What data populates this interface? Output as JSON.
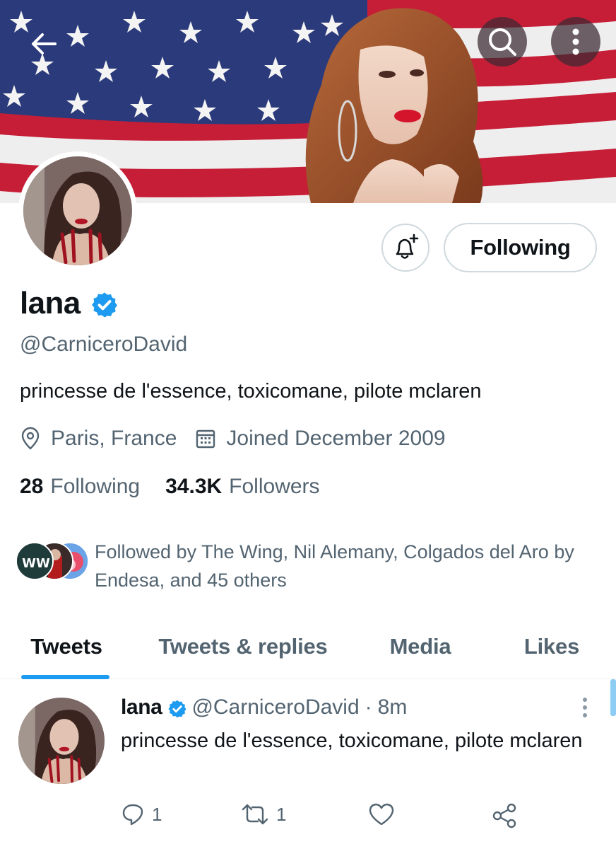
{
  "colors": {
    "accent": "#1d9bf0",
    "text_primary": "#0f1419",
    "text_secondary": "#536471",
    "border": "#cfd9de"
  },
  "header": {
    "back_icon": "arrow-left-icon",
    "search_icon": "search-icon",
    "more_icon": "more-vertical-icon"
  },
  "profile": {
    "display_name": "lana",
    "handle": "@CarniceroDavid",
    "bio": "princesse de l'essence, toxicomane, pilote mclaren",
    "location": "Paris, France",
    "joined": "Joined December 2009",
    "following_count": "28",
    "following_label": "Following",
    "followers_count": "34.3K",
    "followers_label": "Followers",
    "verified_icon": "verified-badge-icon"
  },
  "actions": {
    "notify_icon": "bell-plus-icon",
    "following_button": "Following"
  },
  "followed_by": {
    "text": "Followed by The Wing, Nil Alemany, Colgados del Aro by Endesa, and 45 others",
    "avatar_label": "WW"
  },
  "tabs": [
    {
      "label": "Tweets",
      "active": true
    },
    {
      "label": "Tweets & replies",
      "active": false
    },
    {
      "label": "Media",
      "active": false
    },
    {
      "label": "Likes",
      "active": false
    }
  ],
  "tweet": {
    "name": "lana",
    "handle": "@CarniceroDavid",
    "separator": "·",
    "time": "8m",
    "text": "princesse de l'essence, toxicomane, pilote mclaren",
    "reply_count": "1",
    "retweet_count": "1",
    "like_count": "",
    "share_icon": "share-icon"
  }
}
